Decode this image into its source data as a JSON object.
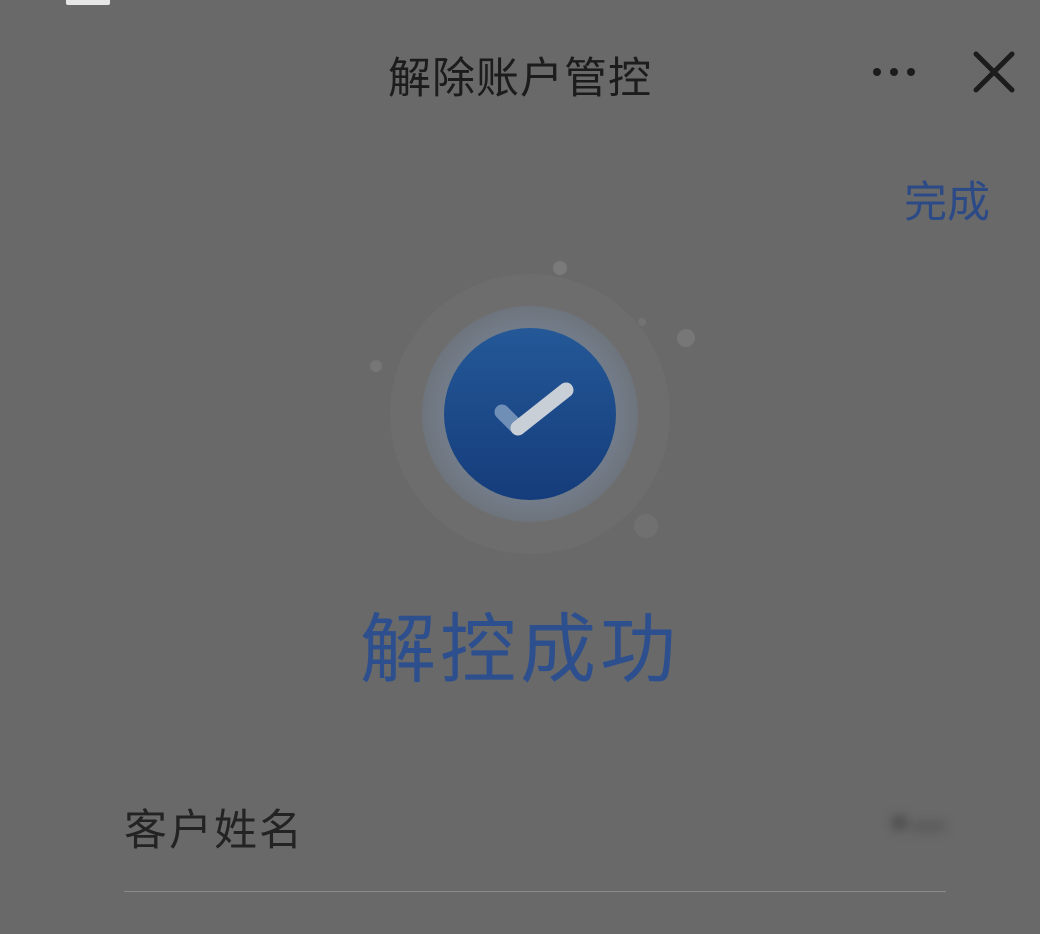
{
  "header": {
    "title": "解除账户管控",
    "more_icon": "more-horizontal-icon",
    "close_icon": "close-icon",
    "done_label": "完成"
  },
  "result": {
    "icon": "check-circle-icon",
    "message": "解控成功"
  },
  "details": [
    {
      "label": "客户姓名",
      "value": "•—"
    }
  ],
  "colors": {
    "overlay_background": "#696969",
    "accent_blue": "#2d4f8e",
    "icon_blue": "#1e5193"
  }
}
